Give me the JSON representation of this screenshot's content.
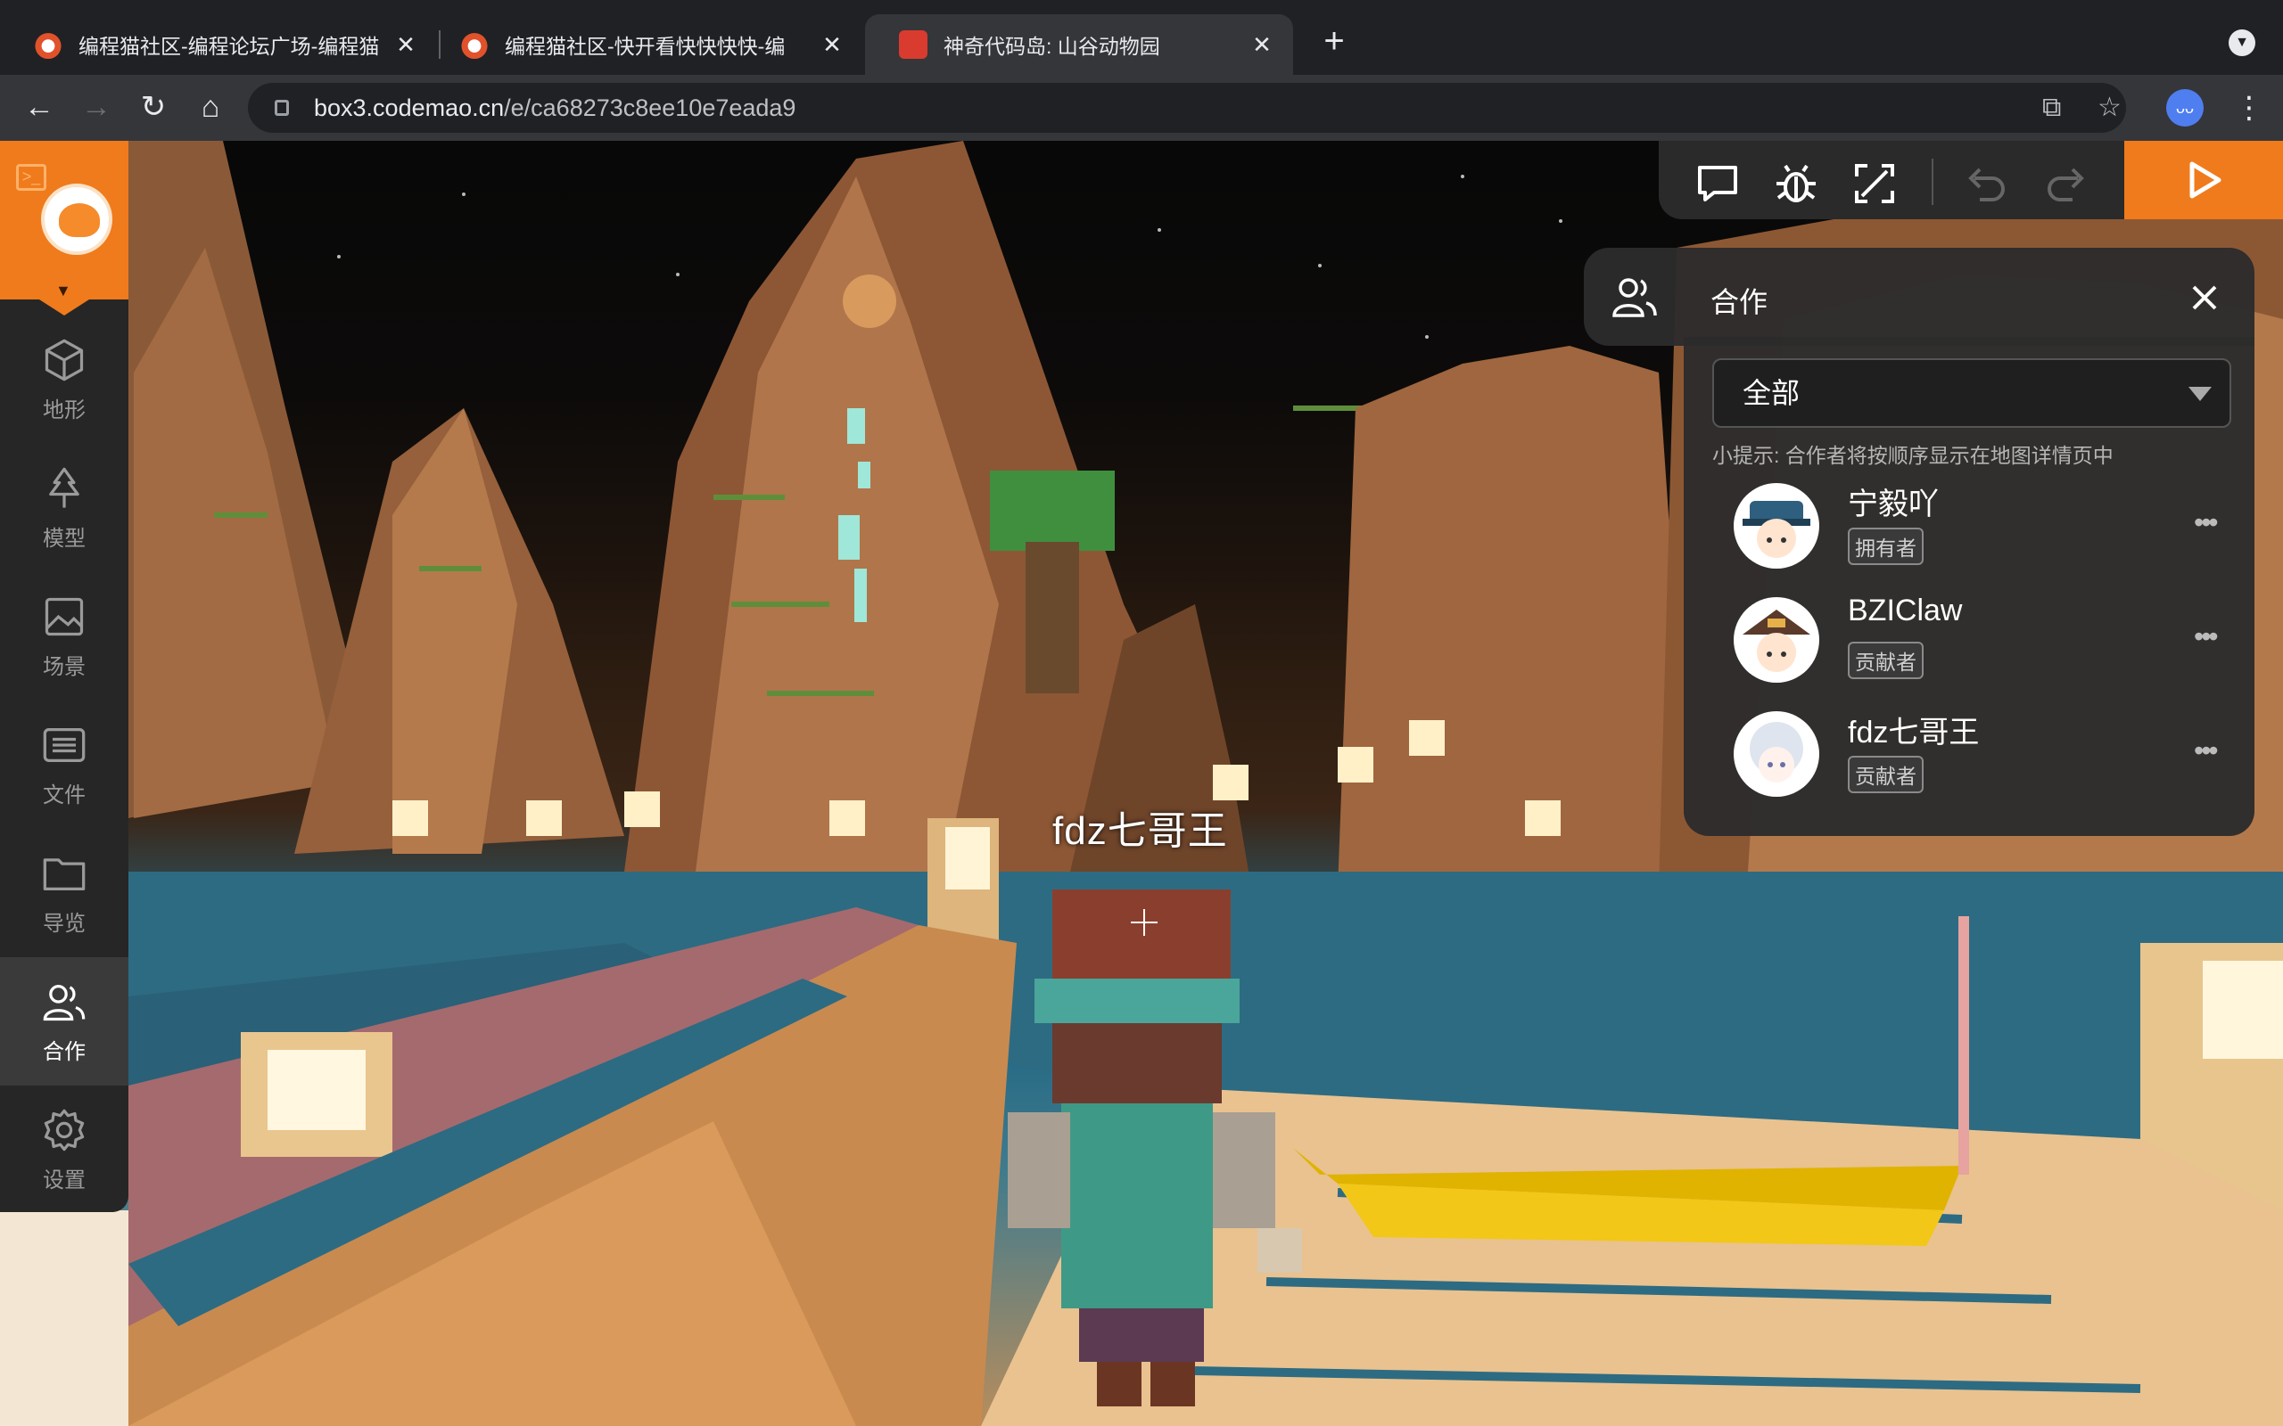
{
  "browser": {
    "tabs": [
      {
        "title": "编程猫社区-编程论坛广场-编程猫",
        "favicon": "codemao-cat-icon",
        "active": false
      },
      {
        "title": "编程猫社区-快开看快快快快-编",
        "favicon": "codemao-cat-icon",
        "active": false
      },
      {
        "title": "神奇代码岛: 山谷动物园",
        "favicon": "box3-island-icon",
        "active": true
      }
    ],
    "new_tab": "+",
    "url_host": "box3.codemao.cn",
    "url_path": "/e/ca68273c8ee10e7eada9"
  },
  "sidebar": {
    "items": [
      {
        "label": "地形",
        "icon": "cube-icon"
      },
      {
        "label": "模型",
        "icon": "tree-icon"
      },
      {
        "label": "场景",
        "icon": "image-icon"
      },
      {
        "label": "文件",
        "icon": "file-icon"
      },
      {
        "label": "导览",
        "icon": "folder-icon"
      },
      {
        "label": "合作",
        "icon": "collaborators-icon",
        "active": true
      },
      {
        "label": "设置",
        "icon": "gear-icon"
      }
    ]
  },
  "editor_toolbar": {
    "buttons": [
      "chat-icon",
      "bug-icon",
      "fullscreen-icon",
      "undo-icon",
      "redo-icon",
      "play-icon"
    ]
  },
  "collab_panel": {
    "title": "合作",
    "filter_selected": "全部",
    "hint": "小提示: 合作者将按顺序显示在地图详情页中",
    "members": [
      {
        "name": "宁毅吖",
        "role": "拥有者"
      },
      {
        "name": "BZIClaw",
        "role": "贡献者"
      },
      {
        "name": "fdz七哥王",
        "role": "贡献者"
      }
    ],
    "more_label": "•••"
  },
  "scene": {
    "player_nametag": "fdz七哥王"
  },
  "colors": {
    "accent": "#f07b1c",
    "panel": "#2c2c2c",
    "sidebar": "#262626"
  }
}
